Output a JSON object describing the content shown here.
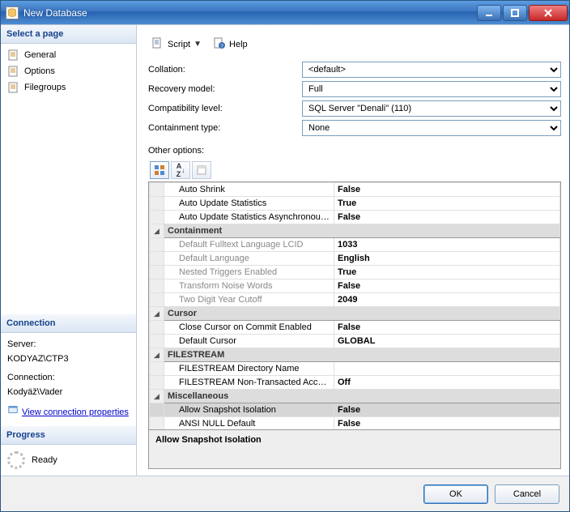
{
  "window": {
    "title": "New Database"
  },
  "sidebar": {
    "selectPageLabel": "Select a page",
    "pages": [
      {
        "label": "General"
      },
      {
        "label": "Options"
      },
      {
        "label": "Filegroups"
      }
    ],
    "connection": {
      "heading": "Connection",
      "serverLabel": "Server:",
      "serverValue": "KODYAZ\\CTP3",
      "connectionLabel": "Connection:",
      "connectionValue": "Kodyäž\\Vader",
      "viewLink": "View connection properties"
    },
    "progress": {
      "heading": "Progress",
      "status": "Ready"
    }
  },
  "toolbar": {
    "scriptLabel": "Script",
    "helpLabel": "Help"
  },
  "form": {
    "collation": {
      "label": "Collation:",
      "value": "<default>"
    },
    "recovery": {
      "label": "Recovery model:",
      "value": "Full"
    },
    "compat": {
      "label": "Compatibility level:",
      "value": "SQL Server \"Denali\" (110)"
    },
    "contain": {
      "label": "Containment type:",
      "value": "None"
    },
    "otherLabel": "Other options:"
  },
  "grid": {
    "rows": [
      {
        "type": "prop",
        "key": "Auto Shrink",
        "val": "False"
      },
      {
        "type": "prop",
        "key": "Auto Update Statistics",
        "val": "True"
      },
      {
        "type": "prop",
        "key": "Auto Update Statistics Asynchronously",
        "val": "False"
      },
      {
        "type": "cat",
        "key": "Containment"
      },
      {
        "type": "prop",
        "key": "Default Fulltext Language LCID",
        "val": "1033",
        "ro": true
      },
      {
        "type": "prop",
        "key": "Default Language",
        "val": "English",
        "ro": true
      },
      {
        "type": "prop",
        "key": "Nested Triggers Enabled",
        "val": "True",
        "ro": true
      },
      {
        "type": "prop",
        "key": "Transform Noise Words",
        "val": "False",
        "ro": true
      },
      {
        "type": "prop",
        "key": "Two Digit Year Cutoff",
        "val": "2049",
        "ro": true
      },
      {
        "type": "cat",
        "key": "Cursor"
      },
      {
        "type": "prop",
        "key": "Close Cursor on Commit Enabled",
        "val": "False"
      },
      {
        "type": "prop",
        "key": "Default Cursor",
        "val": "GLOBAL"
      },
      {
        "type": "cat",
        "key": "FILESTREAM"
      },
      {
        "type": "prop",
        "key": "FILESTREAM Directory Name",
        "val": "",
        "valnormal": true
      },
      {
        "type": "prop",
        "key": "FILESTREAM Non-Transacted Access",
        "val": "Off"
      },
      {
        "type": "cat",
        "key": "Miscellaneous"
      },
      {
        "type": "prop",
        "key": "Allow Snapshot Isolation",
        "val": "False",
        "sel": true
      },
      {
        "type": "prop",
        "key": "ANSI NULL Default",
        "val": "False"
      }
    ],
    "description": "Allow Snapshot Isolation"
  },
  "footer": {
    "ok": "OK",
    "cancel": "Cancel"
  }
}
